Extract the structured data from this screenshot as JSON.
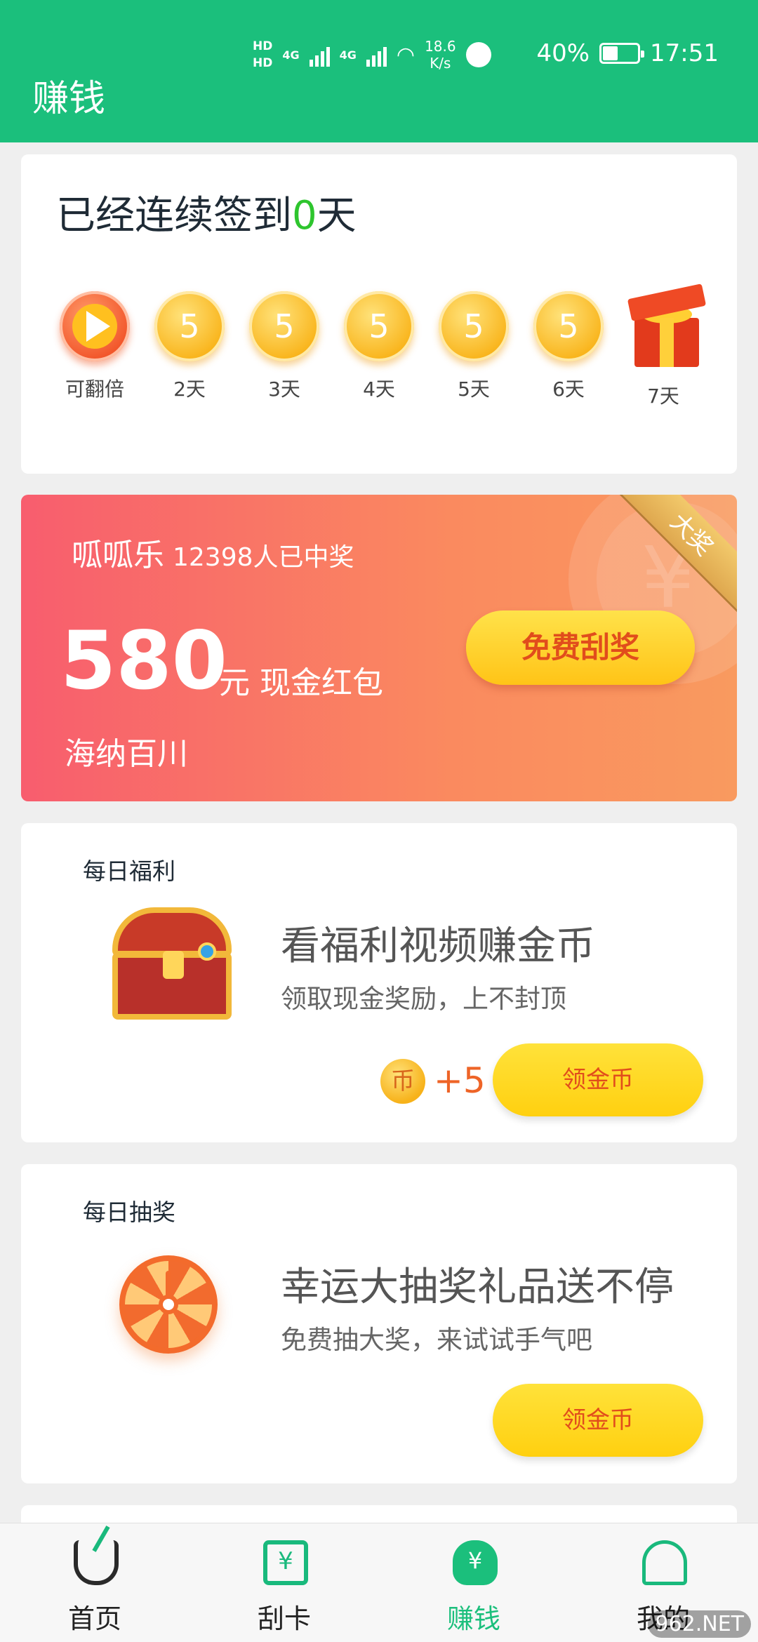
{
  "status_bar": {
    "hd1": "HD",
    "hd2": "HD",
    "net1": "4G",
    "net2": "4G",
    "speed_value": "18.6",
    "speed_unit": "K/s",
    "battery_pct": "40%",
    "time": "17:51",
    "battery_level": 0.4
  },
  "header": {
    "title": "赚钱"
  },
  "checkin": {
    "prefix": "已经连续签到",
    "count": "0",
    "suffix": "天",
    "days": [
      {
        "label": "可翻倍",
        "value": "",
        "icon": "play-icon"
      },
      {
        "label": "2天",
        "value": "5",
        "icon": "coin-icon"
      },
      {
        "label": "3天",
        "value": "5",
        "icon": "coin-icon"
      },
      {
        "label": "4天",
        "value": "5",
        "icon": "coin-icon"
      },
      {
        "label": "5天",
        "value": "5",
        "icon": "coin-icon"
      },
      {
        "label": "6天",
        "value": "5",
        "icon": "coin-icon"
      },
      {
        "label": "7天",
        "value": "",
        "icon": "gift-icon"
      }
    ]
  },
  "scratch": {
    "title": "呱呱乐",
    "winners": "12398人已中奖",
    "amount": "580",
    "unit": "元 现金红包",
    "brand": "海纳百川",
    "ribbon": "大奖",
    "button": "免费刮奖"
  },
  "welfare": {
    "section": "每日福利",
    "title": "看福利视频赚金币",
    "desc": "领取现金奖励，上不封顶",
    "coin_label": "币",
    "reward": "+5",
    "button": "领金币"
  },
  "lottery": {
    "section": "每日抽奖",
    "title": "幸运大抽奖礼品送不停",
    "desc": "免费抽大奖，来试试手气吧",
    "button": "领金币"
  },
  "nav": {
    "items": [
      {
        "label": "首页",
        "icon": "broom-icon"
      },
      {
        "label": "刮卡",
        "icon": "card-icon"
      },
      {
        "label": "赚钱",
        "icon": "moneybag-icon",
        "active": true
      },
      {
        "label": "我的",
        "icon": "user-icon"
      }
    ]
  },
  "watermark": "962.NET",
  "colors": {
    "brand_green": "#1bbf7c",
    "accent_orange": "#e14d1c",
    "gold": "#ffd010"
  }
}
